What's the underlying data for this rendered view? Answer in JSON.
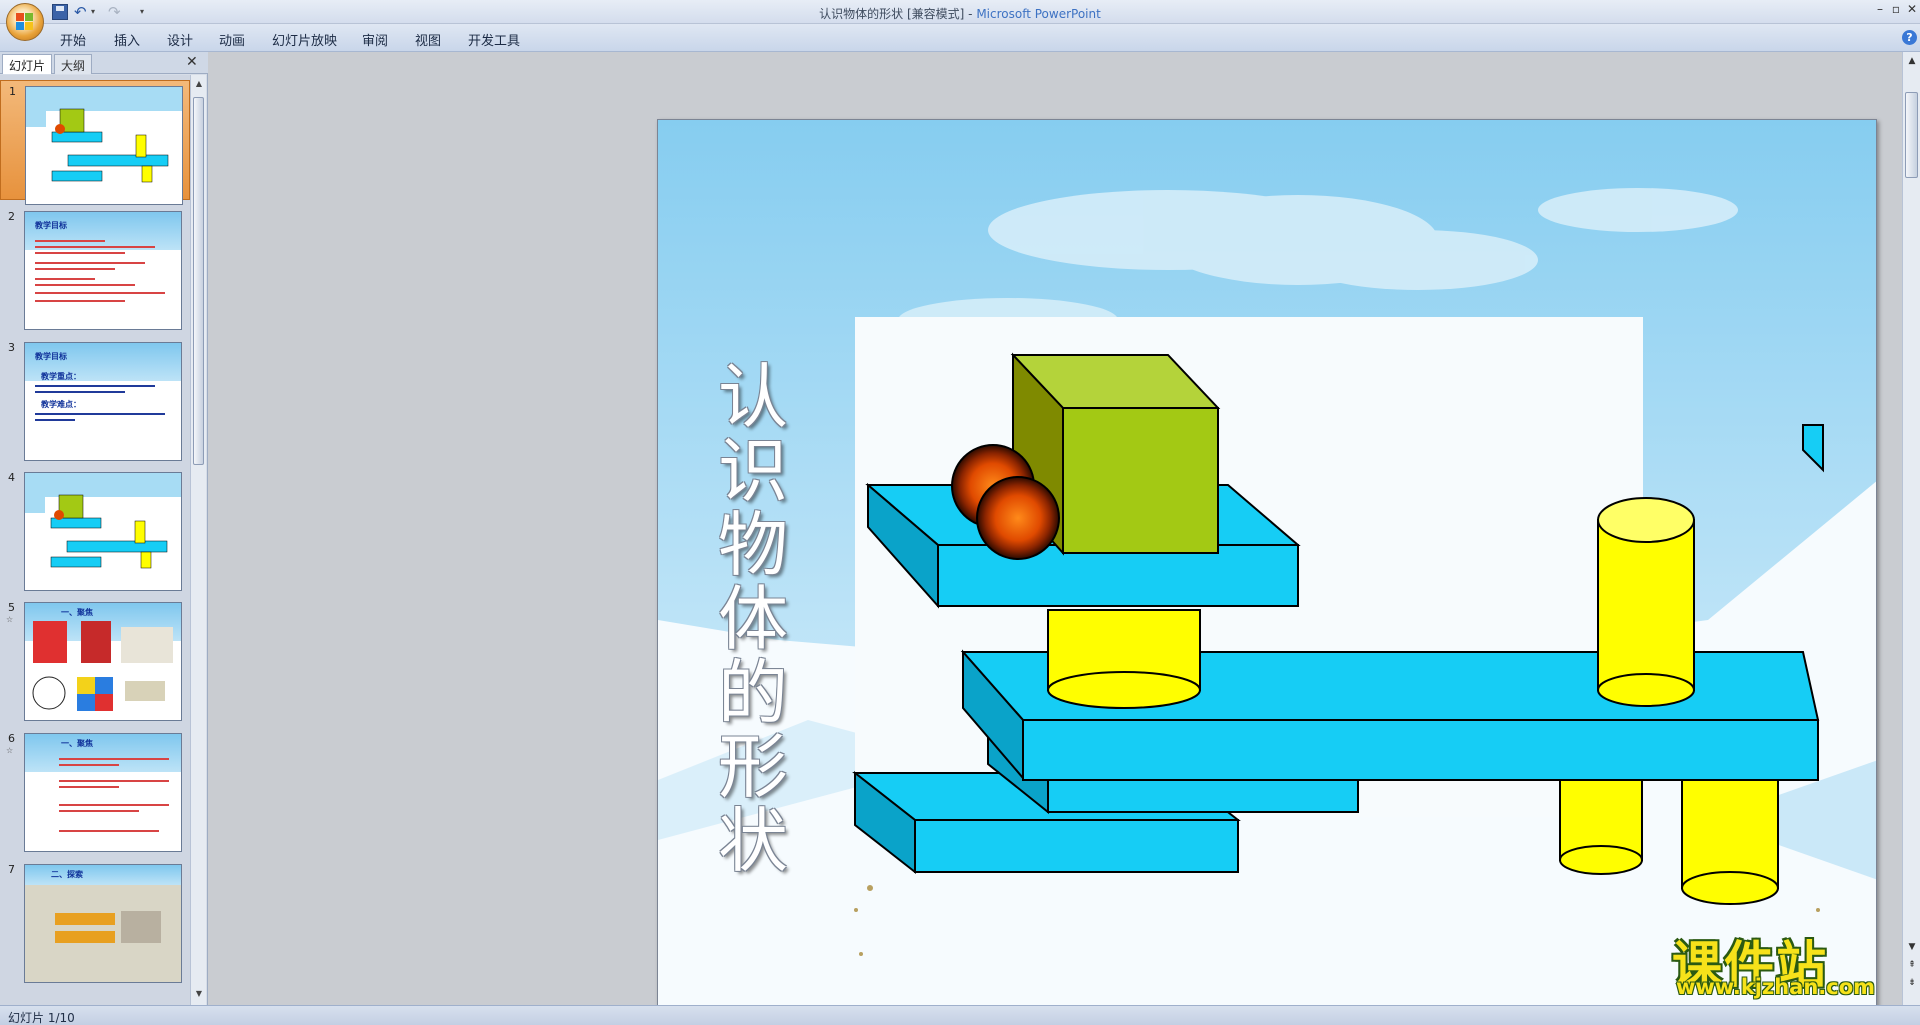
{
  "window": {
    "doc_title": "认识物体的形状 [兼容模式] - ",
    "app_name": "Microsoft PowerPoint"
  },
  "ribbon": {
    "tabs": [
      "开始",
      "插入",
      "设计",
      "动画",
      "幻灯片放映",
      "审阅",
      "视图",
      "开发工具"
    ]
  },
  "panel": {
    "tab_slides": "幻灯片",
    "tab_outline": "大纲",
    "slides": [
      {
        "num": "1",
        "title": ""
      },
      {
        "num": "2",
        "title": "教学目标"
      },
      {
        "num": "3",
        "title": "教学目标",
        "sub1": "教学重点：",
        "sub2": "教学难点："
      },
      {
        "num": "4",
        "title": ""
      },
      {
        "num": "5",
        "title": "一、聚焦"
      },
      {
        "num": "6",
        "title": "一、聚焦"
      },
      {
        "num": "7",
        "title": "二、探索"
      }
    ]
  },
  "slide": {
    "title": "认识物体的形状"
  },
  "status": {
    "slide_label": "幻灯片 1/10"
  },
  "watermark": {
    "title": "课件站",
    "url": "www.kjzhan.com"
  },
  "colors": {
    "block_blue": "#16cdf5",
    "block_blue_dark": "#0aa3c9",
    "cube_green": "#a3c914",
    "cylinder_yellow": "#fffe00",
    "ball_orange": "#e04a00",
    "selected_thumb": "#e7923d",
    "watermark_yellow": "#f6e21a"
  }
}
